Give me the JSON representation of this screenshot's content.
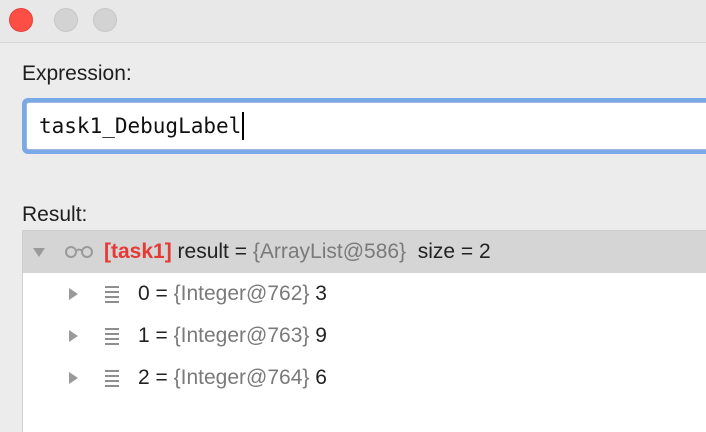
{
  "window": {
    "controls": {
      "close_color": "#fd4e45",
      "minimize_color": "#d3d3d3",
      "maximize_color": "#d3d3d3"
    }
  },
  "expression": {
    "label": "Expression:",
    "value": "task1_DebugLabel"
  },
  "result": {
    "label": "Result:",
    "root": {
      "label_tag": "[task1]",
      "name": " result = ",
      "ref": "{ArrayList@586}",
      "extra": "  size = 2",
      "icon": "glasses-icon",
      "expanded": true
    },
    "items": [
      {
        "index": "0 = ",
        "ref": "{Integer@762}",
        "value": " 3",
        "icon": "list-icon"
      },
      {
        "index": "1 = ",
        "ref": "{Integer@763}",
        "value": " 9",
        "icon": "list-icon"
      },
      {
        "index": "2 = ",
        "ref": "{Integer@764}",
        "value": " 6",
        "icon": "list-icon"
      }
    ]
  },
  "colors": {
    "label_tag": "#e53935",
    "reference": "#7a7a7a",
    "selection": "#d5d5d5",
    "focus_ring": "#79a9e6"
  }
}
